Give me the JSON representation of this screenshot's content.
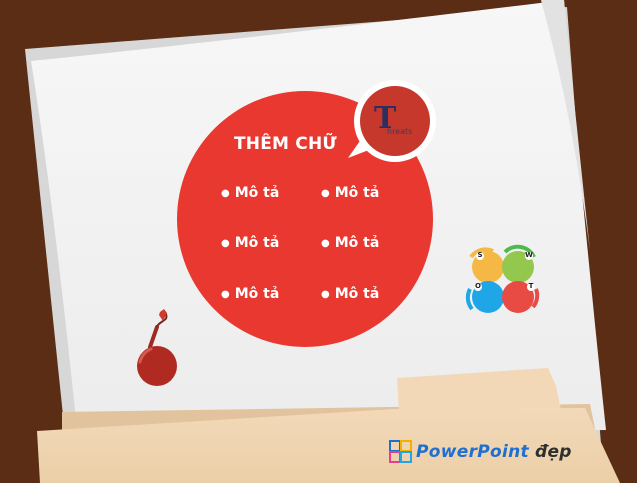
{
  "slide": {
    "title": "THÊM CHỮ",
    "bullets": [
      "Mô tả",
      "Mô tả",
      "Mô tả",
      "Mô tả",
      "Mô tả",
      "Mô tả"
    ],
    "threats_badge": {
      "letter": "T",
      "word": "hreats"
    },
    "swot_icon": {
      "letters": [
        "S",
        "W",
        "O",
        "T"
      ]
    },
    "logo": {
      "part1": "Power",
      "part2": "Point",
      "part3": "đẹp"
    }
  },
  "colors": {
    "background": "#5a2d14",
    "paper": "#f3f3f3",
    "circle_red": "#e8382f",
    "badge_red": "#c6372c",
    "folder": "#f0d6b4",
    "folder_shadow": "#e0c09a",
    "swot_orange": "#f6b845",
    "swot_green": "#93c74d",
    "swot_blue": "#1ea6e6",
    "swot_red": "#e84b43"
  },
  "icons": {
    "bomb": "bomb-icon",
    "swot": "swot-icon",
    "logo": "powerpoint-logo-icon"
  }
}
